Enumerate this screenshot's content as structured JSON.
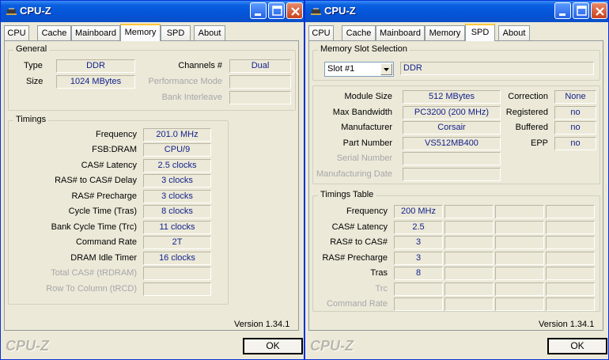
{
  "left": {
    "title": "CPU-Z",
    "tabs": [
      "CPU",
      "Cache",
      "Mainboard",
      "Memory",
      "SPD",
      "About"
    ],
    "active_tab": "Memory",
    "general": {
      "title": "General",
      "type_label": "Type",
      "type_value": "DDR",
      "size_label": "Size",
      "size_value": "1024 MBytes",
      "channels_label": "Channels #",
      "channels_value": "Dual",
      "perf_mode_label": "Performance Mode",
      "bank_interleave_label": "Bank Interleave"
    },
    "timings": {
      "title": "Timings",
      "rows": [
        {
          "label": "Frequency",
          "value": "201.0 MHz"
        },
        {
          "label": "FSB:DRAM",
          "value": "CPU/9"
        },
        {
          "label": "CAS# Latency",
          "value": "2.5 clocks"
        },
        {
          "label": "RAS# to CAS# Delay",
          "value": "3 clocks"
        },
        {
          "label": "RAS# Precharge",
          "value": "3 clocks"
        },
        {
          "label": "Cycle Time (Tras)",
          "value": "8 clocks"
        },
        {
          "label": "Bank Cycle Time (Trc)",
          "value": "11 clocks"
        },
        {
          "label": "Command Rate",
          "value": "2T"
        },
        {
          "label": "DRAM Idle Timer",
          "value": "16 clocks"
        },
        {
          "label": "Total CAS# (tRDRAM)",
          "value": ""
        },
        {
          "label": "Row To Column (tRCD)",
          "value": ""
        }
      ]
    },
    "version": "Version 1.34.1",
    "brand": "CPU-Z",
    "ok_label": "OK"
  },
  "right": {
    "title": "CPU-Z",
    "tabs": [
      "CPU",
      "Cache",
      "Mainboard",
      "Memory",
      "SPD",
      "About"
    ],
    "active_tab": "SPD",
    "slot_selection": {
      "title": "Memory Slot Selection",
      "slot_value": "Slot #1",
      "type_value": "DDR"
    },
    "module": {
      "module_size_label": "Module Size",
      "module_size_value": "512 MBytes",
      "max_bw_label": "Max Bandwidth",
      "max_bw_value": "PC3200 (200 MHz)",
      "manufacturer_label": "Manufacturer",
      "manufacturer_value": "Corsair",
      "part_label": "Part Number",
      "part_value": "VS512MB400",
      "serial_label": "Serial Number",
      "mfg_date_label": "Manufacturing Date",
      "correction_label": "Correction",
      "correction_value": "None",
      "registered_label": "Registered",
      "registered_value": "no",
      "buffered_label": "Buffered",
      "buffered_value": "no",
      "epp_label": "EPP",
      "epp_value": "no"
    },
    "timings_table": {
      "title": "Timings Table",
      "rows": [
        {
          "label": "Frequency",
          "value": "200 MHz"
        },
        {
          "label": "CAS# Latency",
          "value": "2.5"
        },
        {
          "label": "RAS# to CAS#",
          "value": "3"
        },
        {
          "label": "RAS# Precharge",
          "value": "3"
        },
        {
          "label": "Tras",
          "value": "8"
        },
        {
          "label": "Trc",
          "value": ""
        },
        {
          "label": "Command Rate",
          "value": ""
        }
      ]
    },
    "version": "Version 1.34.1",
    "brand": "CPU-Z",
    "ok_label": "OK"
  }
}
